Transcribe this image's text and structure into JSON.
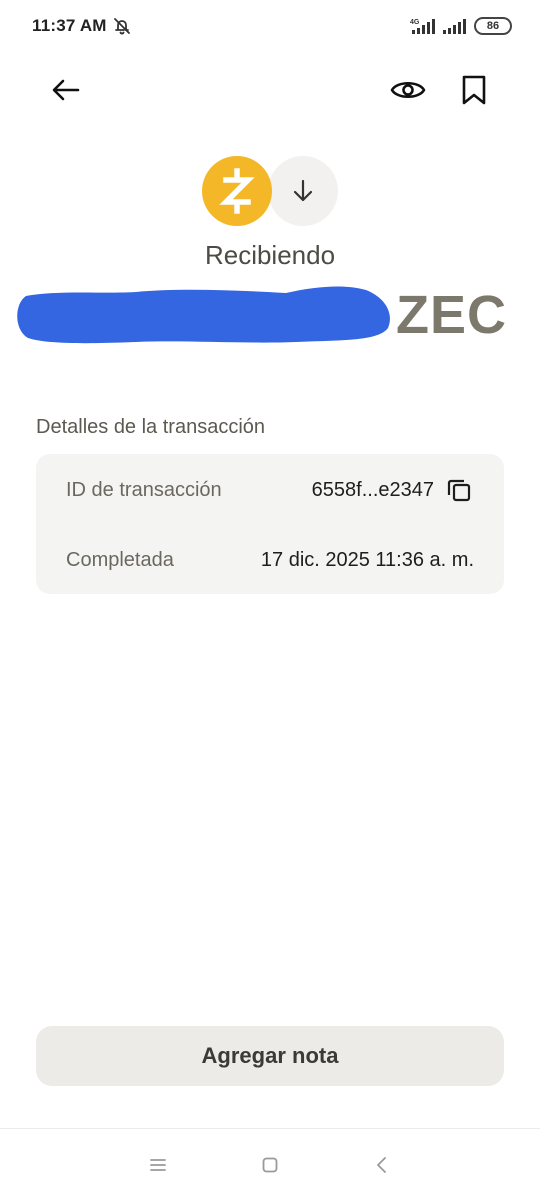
{
  "status_bar": {
    "time": "11:37 AM",
    "network_label": "4G",
    "battery": "86",
    "icons": [
      "dnd-icon",
      "signal-icon",
      "signal-icon",
      "battery-icon"
    ]
  },
  "top_bar": {
    "icons": [
      "back-arrow-icon",
      "eye-icon",
      "bookmark-icon"
    ]
  },
  "header": {
    "coin_icon": "zec-logo-icon",
    "direction_icon": "arrow-down-icon",
    "status": "Recibiendo",
    "amount_currency": "ZEC",
    "colors": {
      "zec": "#f4b728",
      "redaction": "#3366e0"
    }
  },
  "details": {
    "section_title": "Detalles de la transacción",
    "rows": [
      {
        "label": "ID de transacción",
        "value": "6558f...e2347",
        "icon": "copy-icon"
      },
      {
        "label": "Completada",
        "value": "17 dic. 2025 11:36 a. m."
      }
    ]
  },
  "actions": {
    "add_note_label": "Agregar nota"
  },
  "nav_bar": {
    "icons": [
      "menu-icon",
      "home-icon",
      "back-icon"
    ]
  }
}
